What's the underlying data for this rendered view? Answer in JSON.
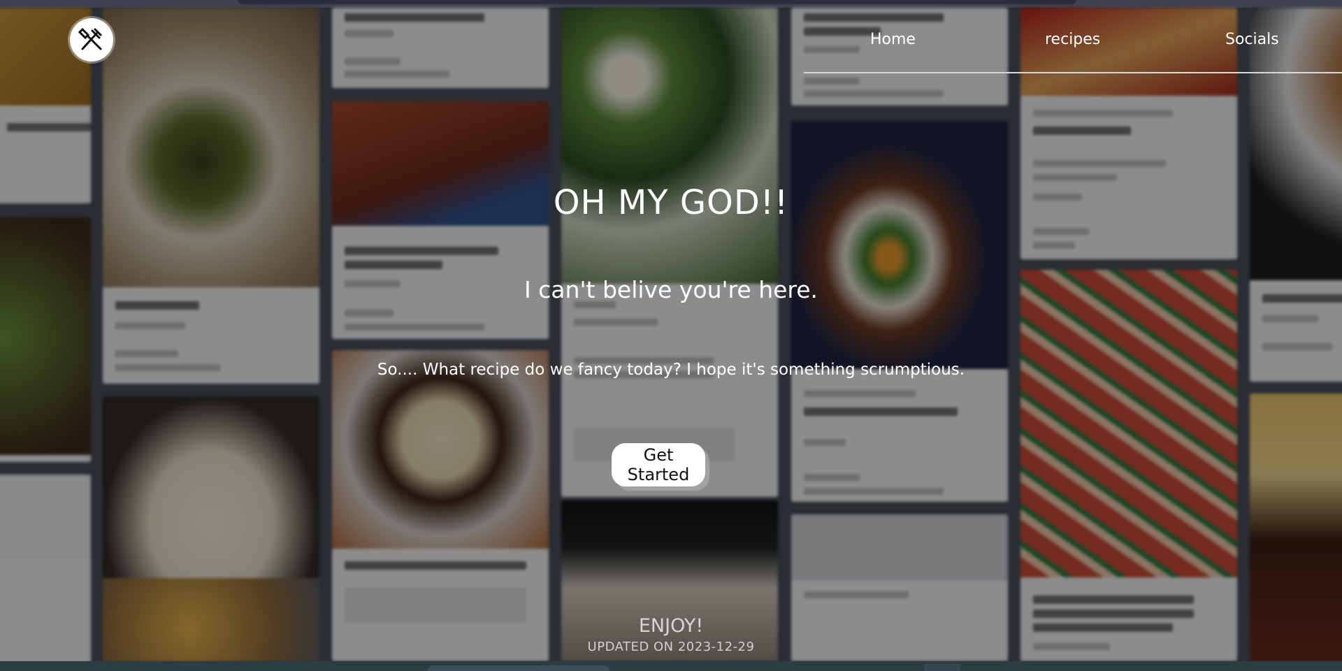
{
  "nav": {
    "items": [
      {
        "label": "Home"
      },
      {
        "label": "recipes"
      },
      {
        "label": "Socials"
      }
    ]
  },
  "logo": {
    "icon": "fork-and-spatula-icon"
  },
  "hero": {
    "title": "OH MY GOD!!",
    "subtitle": "I can't belive you're here.",
    "tagline": "So.... What recipe do we fancy today? I hope it's something scrumptious.",
    "cta_label": "Get Started"
  },
  "footer": {
    "enjoy": "ENJOY!",
    "updated": "UPDATED ON 2023-12-29"
  },
  "colors": {
    "text": "#ffffff",
    "button_bg": "#ffffff",
    "button_text": "#111111",
    "overlay_dark": "#2a2d33"
  }
}
